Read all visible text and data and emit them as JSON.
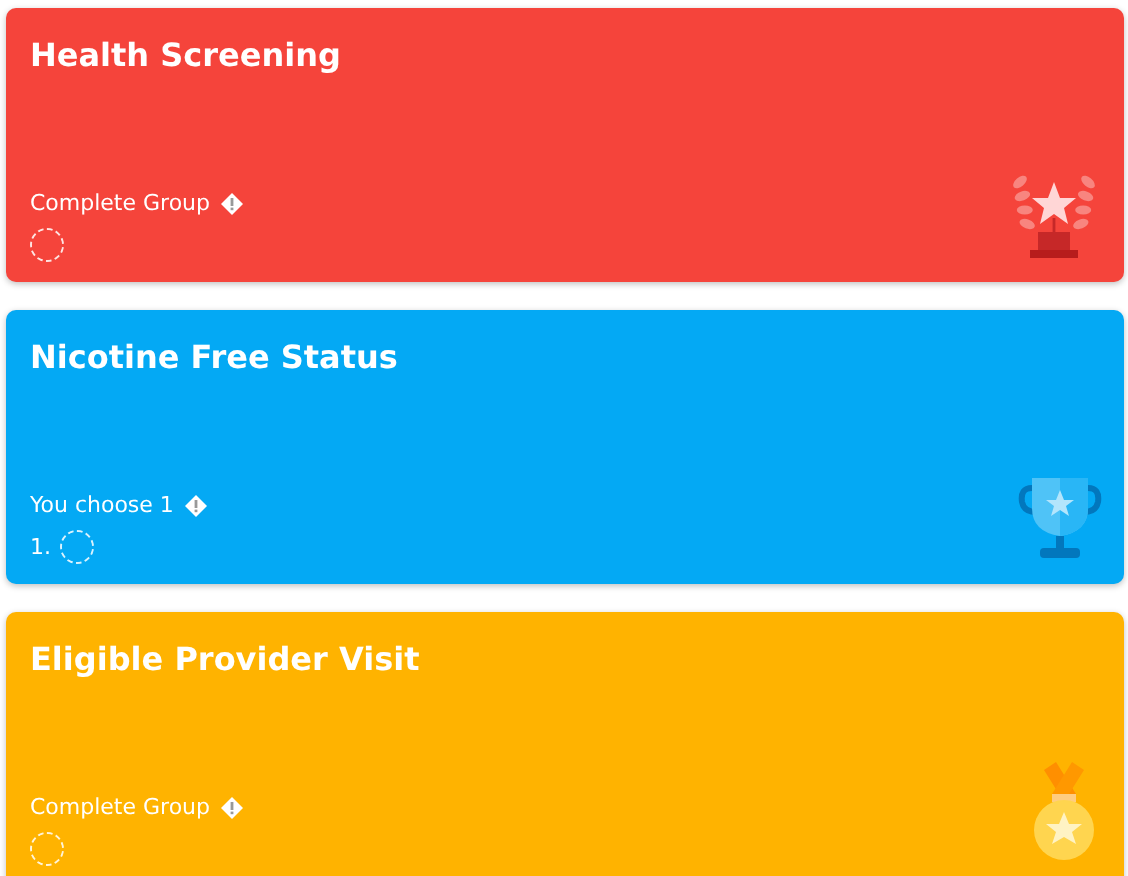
{
  "cards": [
    {
      "title": "Health Screening",
      "color": "#f5443b",
      "requirement": "Complete Group",
      "kind": "laurel",
      "items": [
        {
          "done": false
        }
      ]
    },
    {
      "title": "Nicotine Free Status",
      "color": "#04a9f4",
      "requirement": "You choose 1",
      "kind": "trophy",
      "items": [
        {
          "number": "1.",
          "done": false
        }
      ]
    },
    {
      "title": "Eligible Provider Visit",
      "color": "#ffb300",
      "requirement": "Complete Group",
      "kind": "medal",
      "items": [
        {
          "done": false
        }
      ]
    }
  ]
}
